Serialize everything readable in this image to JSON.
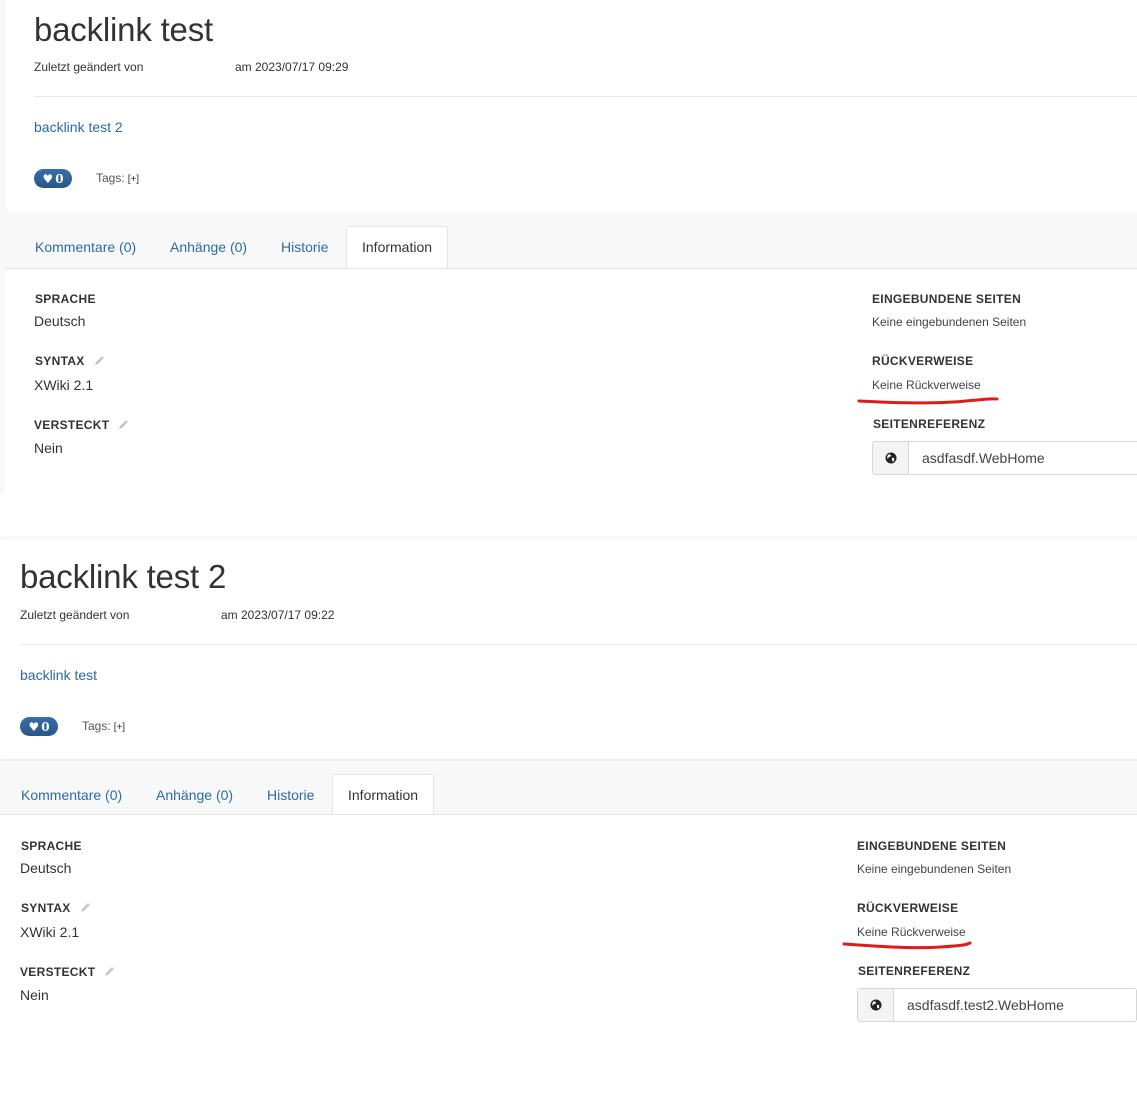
{
  "pages": [
    {
      "title": "backlink test",
      "meta_prefix": "Zuletzt geändert von",
      "meta_date": "am 2023/07/17 09:29",
      "content_link": "backlink test 2",
      "likes": "0",
      "tags_label": "Tags:",
      "tags_add": "[+]",
      "tabs": [
        {
          "label": "Kommentare (0)"
        },
        {
          "label": "Anhänge (0)"
        },
        {
          "label": "Historie"
        },
        {
          "label": "Information",
          "active": true
        }
      ],
      "info": {
        "language_label": "SPRACHE",
        "language_value": "Deutsch",
        "syntax_label": "SYNTAX",
        "syntax_value": "XWiki 2.1",
        "hidden_label": "VERSTECKT",
        "hidden_value": "Nein",
        "included_label": "EINGEBUNDENE SEITEN",
        "included_value": "Keine eingebundenen Seiten",
        "backlinks_label": "RÜCKVERWEISE",
        "backlinks_value": "Keine Rückverweise",
        "reference_label": "SEITENREFERENZ",
        "reference_value": "asdfasdf.WebHome"
      }
    },
    {
      "title": "backlink test 2",
      "meta_prefix": "Zuletzt geändert von",
      "meta_date": "am 2023/07/17 09:22",
      "content_link": "backlink test",
      "likes": "0",
      "tags_label": "Tags:",
      "tags_add": "[+]",
      "tabs": [
        {
          "label": "Kommentare (0)"
        },
        {
          "label": "Anhänge (0)"
        },
        {
          "label": "Historie"
        },
        {
          "label": "Information",
          "active": true
        }
      ],
      "info": {
        "language_label": "SPRACHE",
        "language_value": "Deutsch",
        "syntax_label": "SYNTAX",
        "syntax_value": "XWiki 2.1",
        "hidden_label": "VERSTECKT",
        "hidden_value": "Nein",
        "included_label": "EINGEBUNDENE SEITEN",
        "included_value": "Keine eingebundenen Seiten",
        "backlinks_label": "RÜCKVERWEISE",
        "backlinks_value": "Keine Rückverweise",
        "reference_label": "SEITENREFERENZ",
        "reference_value": "asdfasdf.test2.WebHome"
      }
    }
  ],
  "colors": {
    "link": "#2a6ba8",
    "like_button": "#2f5f96",
    "annotation": "#e01b1b"
  },
  "icons": {
    "like": "heart-icon",
    "edit": "pencil-icon",
    "reference": "globe-icon"
  }
}
